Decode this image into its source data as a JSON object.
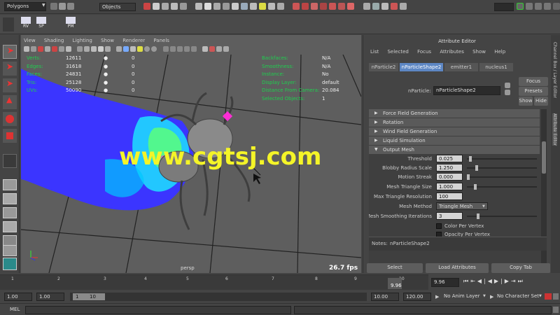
{
  "top_bar": {
    "mode": "Polygons",
    "selection_mask": "Objects",
    "search_field": ""
  },
  "shelf": {
    "labels": [
      "RV",
      "SP",
      "PM"
    ]
  },
  "viewport": {
    "menus": [
      "View",
      "Shading",
      "Lighting",
      "Show",
      "Renderer",
      "Panels"
    ],
    "hud_left": [
      {
        "label": "Verts:",
        "v1": "12611",
        "v2": "0"
      },
      {
        "label": "Edges:",
        "v1": "31618",
        "v2": "0"
      },
      {
        "label": "Faces:",
        "v1": "24831",
        "v2": "0"
      },
      {
        "label": "Tris:",
        "v1": "25128",
        "v2": "0"
      },
      {
        "label": "UVs:",
        "v1": "50090",
        "v2": "0"
      }
    ],
    "hud_right": [
      {
        "label": "Backfaces:",
        "value": "N/A"
      },
      {
        "label": "Smoothness:",
        "value": "N/A"
      },
      {
        "label": "Instance:",
        "value": "No"
      },
      {
        "label": "Display Layer:",
        "value": "default"
      },
      {
        "label": "Distance From Camera:",
        "value": "20.084"
      },
      {
        "label": "Selected Objects:",
        "value": "1"
      }
    ],
    "camera": "persp",
    "fps": "26.7 fps",
    "watermark": "www.cgtsj.com"
  },
  "attribute_editor": {
    "title": "Attribute Editor",
    "menus": [
      "List",
      "Selected",
      "Focus",
      "Attributes",
      "Show",
      "Help"
    ],
    "tabs": [
      "nParticle2",
      "nParticleShape2",
      "emitter1",
      "nucleus1"
    ],
    "node_label": "nParticle:",
    "node_value": "nParticleShape2",
    "buttons": {
      "focus": "Focus",
      "presets": "Presets",
      "show": "Show",
      "hide": "Hide"
    },
    "sections": [
      "Force Field Generation",
      "Rotation",
      "Wind Field Generation",
      "Liquid Simulation",
      "Output Mesh"
    ],
    "attributes": [
      {
        "label": "Threshold",
        "value": "0.025",
        "slider": 0.03
      },
      {
        "label": "Blobby Radius Scale",
        "value": "1.250",
        "slider": 0.12
      },
      {
        "label": "Motion Streak",
        "value": "0.000",
        "slider": 0.0
      },
      {
        "label": "Mesh Triangle Size",
        "value": "1.000",
        "slider": 0.1
      },
      {
        "label": "Max Triangle Resolution",
        "value": "100"
      },
      {
        "label": "Mesh Method",
        "value": "Triangle Mesh"
      },
      {
        "label": "Mesh Smoothing Iterations",
        "value": "3",
        "slider": 0.15
      }
    ],
    "checkboxes": [
      "Color Per Vertex",
      "Opacity Per Vertex"
    ],
    "notes_label": "Notes:",
    "notes_value": "nParticleShape2",
    "bottom_buttons": [
      "Select",
      "Load Attributes",
      "Copy Tab"
    ]
  },
  "side_tabs": [
    "Channel Box / Layer Editor",
    "Attribute Editor"
  ],
  "timeline": {
    "ticks": [
      "1",
      "2",
      "3",
      "4",
      "5",
      "6",
      "7",
      "8",
      "9",
      "10"
    ],
    "current_frame_marker": "9.96",
    "current_frame_field": "9.96",
    "start": "1.00",
    "start2": "1.00",
    "range_start": "1",
    "range_end": "10",
    "end": "10.00",
    "end2": "120.00",
    "anim_layer": "No Anim Layer",
    "char_set": "No Character Set"
  },
  "command_line": {
    "label": "MEL"
  },
  "colors": {
    "hud_green": "#1fcf4f",
    "active_tab": "#5d87c4",
    "viewport_bg": "#5e5e5e"
  }
}
